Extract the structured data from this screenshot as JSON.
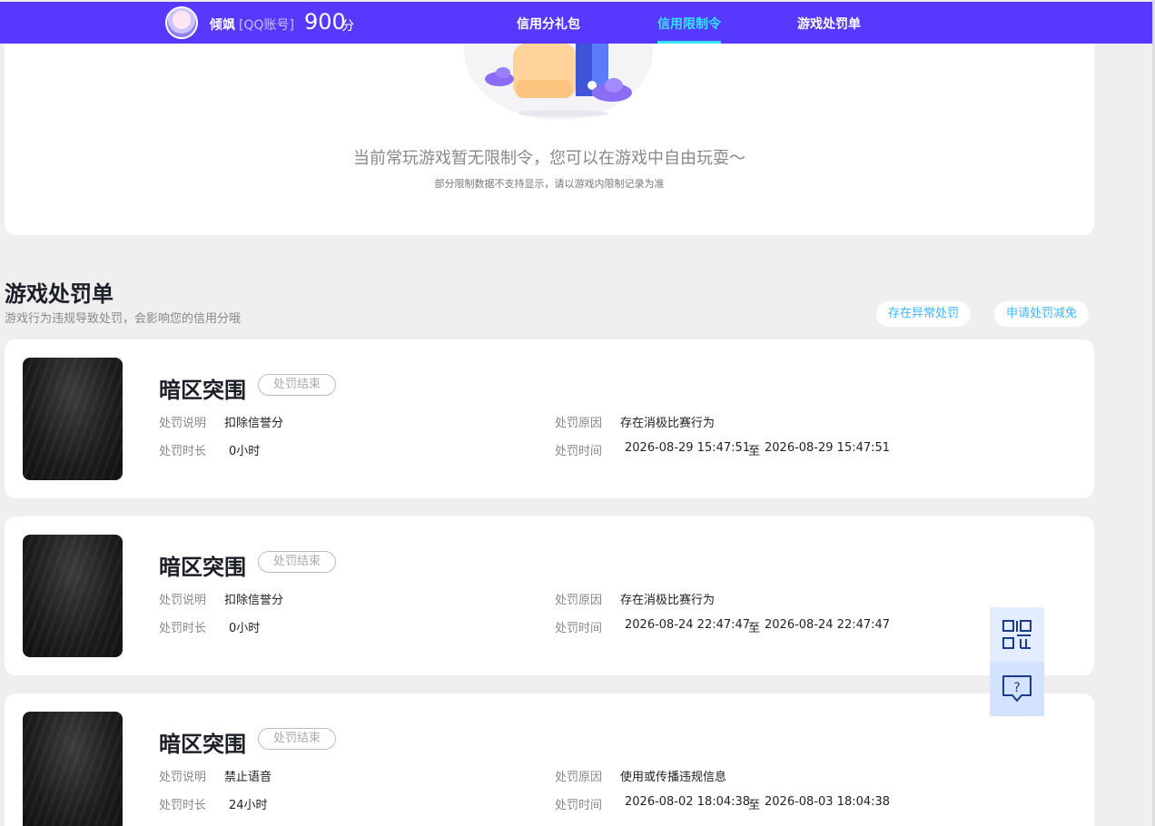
{
  "header": {
    "user_name": "倾飒",
    "account_type": "[QQ账号]",
    "score": "900",
    "score_unit": "分",
    "tabs": [
      {
        "label": "信用分礼包"
      },
      {
        "label": "信用限制令"
      },
      {
        "label": "游戏处罚单"
      }
    ]
  },
  "restriction": {
    "title": "当前常玩游戏暂无限制令，您可以在游戏中自由玩耍～",
    "subtitle": "部分限制数据不支持显示，请以游戏内限制记录为准"
  },
  "penalty_section": {
    "title": "游戏处罚单",
    "subtitle": "游戏行为违规导致处罚，会影响您的信用分哦",
    "btn_abnormal": "存在异常处罚",
    "btn_reduce": "申请处罚减免"
  },
  "labels": {
    "desc": "处罚说明",
    "duration": "处罚时长",
    "reason": "处罚原因",
    "time": "处罚时间",
    "to": "至"
  },
  "penalties": [
    {
      "game": "暗区突围",
      "status": "处罚结束",
      "desc": "扣除信誉分",
      "duration": "0小时",
      "reason": "存在消极比赛行为",
      "start": "2026-08-29 15:47:51",
      "end": "2026-08-29 15:47:51"
    },
    {
      "game": "暗区突围",
      "status": "处罚结束",
      "desc": "扣除信誉分",
      "duration": "0小时",
      "reason": "存在消极比赛行为",
      "start": "2026-08-24 22:47:47",
      "end": "2026-08-24 22:47:47"
    },
    {
      "game": "暗区突围",
      "status": "处罚结束",
      "desc": "禁止语音",
      "duration": "24小时",
      "reason": "使用或传播违规信息",
      "start": "2026-08-02 18:04:38",
      "end": "2026-08-03 18:04:38"
    }
  ],
  "floating": {
    "qr_icon": "qr-code-icon",
    "help_icon": "help-chat-icon"
  },
  "colors": {
    "brand": "#5638ff",
    "active_tab": "#35e3ff",
    "link_blue": "#3fb7ff",
    "page_bg": "#efefef"
  }
}
